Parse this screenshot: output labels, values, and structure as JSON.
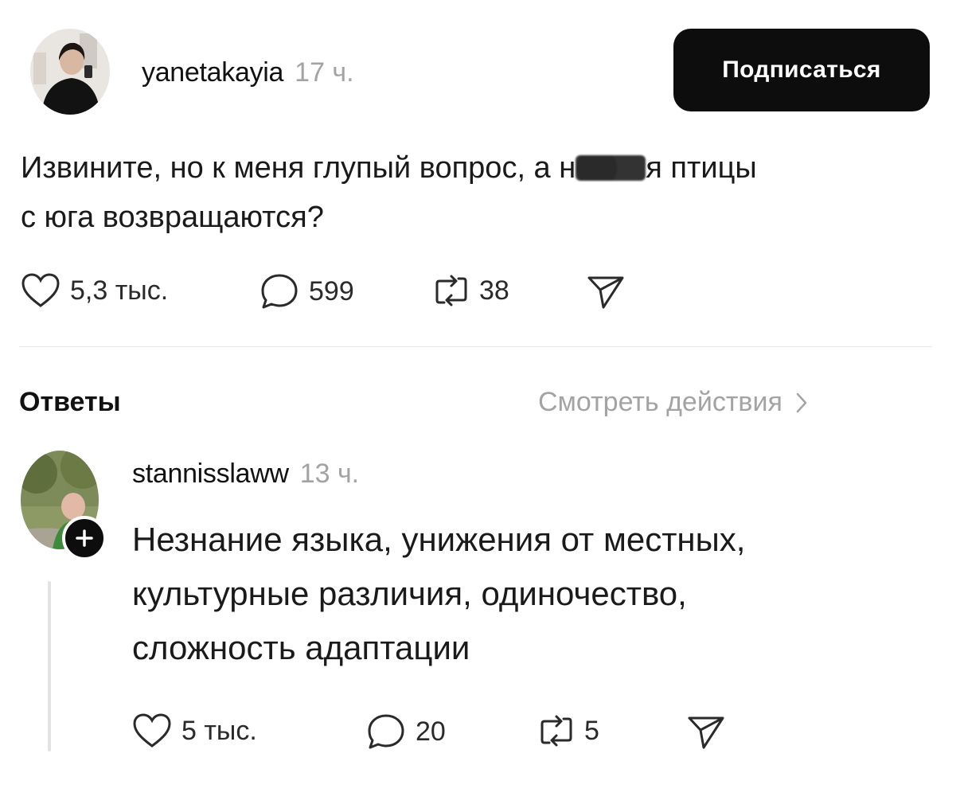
{
  "post": {
    "username": "yanetakayia",
    "time": "17 ч.",
    "follow_label": "Подписаться",
    "text_line1_before": "Извините, но к меня глупый вопрос, а н",
    "text_line1_after": "я птицы",
    "text_line2": "с юга возвращаются?",
    "stats": {
      "likes": "5,3 тыс.",
      "comments": "599",
      "reposts": "38"
    }
  },
  "replies_section": {
    "title": "Ответы",
    "view_actions_label": "Смотреть действия"
  },
  "reply": {
    "username": "stannisslaww",
    "time": "13 ч.",
    "text_lines": [
      "Незнание языка, унижения от местных,",
      "культурные различия, одиночество,",
      "сложность адаптации"
    ],
    "stats": {
      "likes": "5 тыс.",
      "comments": "20",
      "reposts": "5"
    }
  },
  "icons": {
    "like": "heart-icon",
    "comment": "comment-bubble-icon",
    "repost": "repost-icon",
    "share": "send-icon",
    "chevron": "chevron-right-icon",
    "plus": "plus-icon"
  },
  "colors": {
    "follow_button": "#0d0d0d",
    "muted_text": "#a3a3a3"
  }
}
